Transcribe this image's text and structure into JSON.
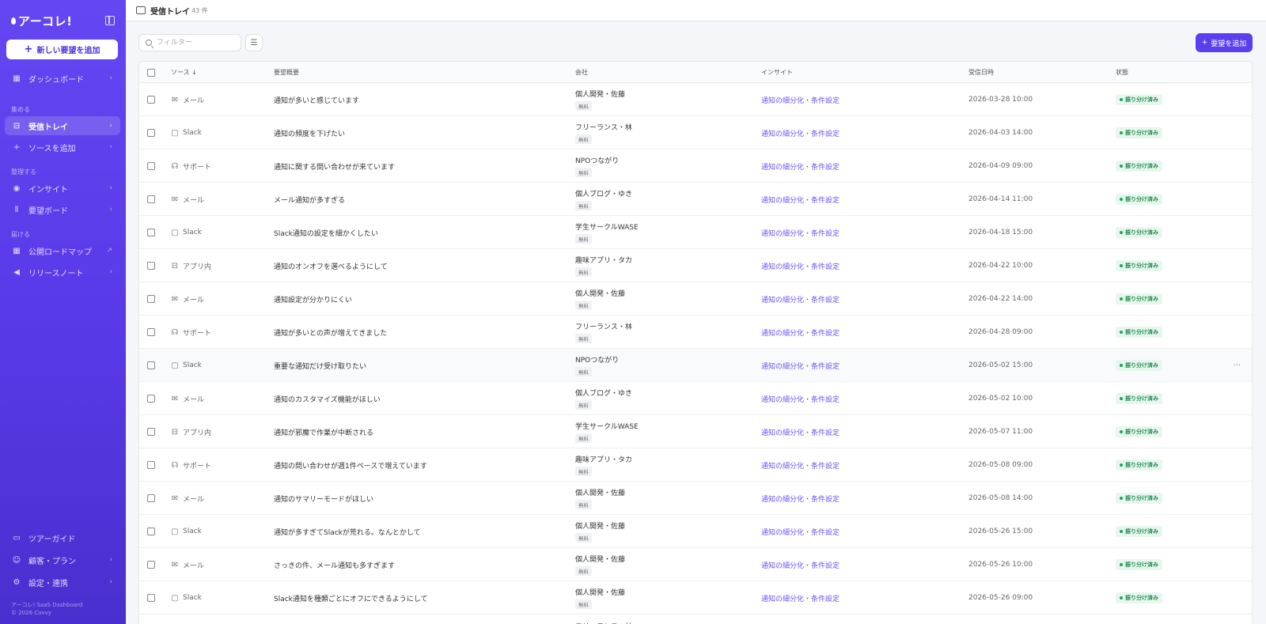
{
  "sidebar": {
    "logo": "アーコレ!",
    "new_button": "新しい要望を追加",
    "dashboard": "ダッシュボード",
    "section_collect": "集める",
    "inbox": "受信トレイ",
    "add_source": "ソースを追加",
    "section_organize": "整理する",
    "insight": "インサイト",
    "board": "要望ボード",
    "section_deliver": "届ける",
    "roadmap": "公開ロードマップ",
    "release_notes": "リリースノート",
    "tour_guide": "ツアーガイド",
    "customers": "顧客・プラン",
    "settings": "設定・連携",
    "footer_line1": "アーコレ! SaaS Dashboard",
    "footer_line2": "© 2026 Covvy"
  },
  "header": {
    "title": "受信トレイ",
    "count": "43 件"
  },
  "toolbar": {
    "filter_placeholder": "フィルター",
    "add_button": "要望を追加"
  },
  "table": {
    "columns": {
      "source": "ソース ↓",
      "summary": "要望概要",
      "company": "会社",
      "insight": "インサイト",
      "date": "受信日時",
      "status": "状態"
    },
    "rows": [
      {
        "source": "メール",
        "icon": "mail",
        "summary": "通知が多いと感じています",
        "company": "個人開発・佐藤",
        "plan": "無料",
        "insight": "通知の細分化・条件設定",
        "date": "2026-03-28 10:00",
        "status": "振り分け済み"
      },
      {
        "source": "Slack",
        "icon": "chat",
        "summary": "通知の頻度を下げたい",
        "company": "フリーランス・林",
        "plan": "無料",
        "insight": "通知の細分化・条件設定",
        "date": "2026-04-03 14:00",
        "status": "振り分け済み"
      },
      {
        "source": "サポート",
        "icon": "headset",
        "summary": "通知に関する問い合わせが来ています",
        "company": "NPOつながり",
        "plan": "無料",
        "insight": "通知の細分化・条件設定",
        "date": "2026-04-09 09:00",
        "status": "振り分け済み"
      },
      {
        "source": "メール",
        "icon": "mail",
        "summary": "メール通知が多すぎる",
        "company": "個人ブログ・ゆき",
        "plan": "無料",
        "insight": "通知の細分化・条件設定",
        "date": "2026-04-14 11:00",
        "status": "振り分け済み"
      },
      {
        "source": "Slack",
        "icon": "chat",
        "summary": "Slack通知の設定を細かくしたい",
        "company": "学生サークルWASE",
        "plan": "無料",
        "insight": "通知の細分化・条件設定",
        "date": "2026-04-18 15:00",
        "status": "振り分け済み"
      },
      {
        "source": "アプリ内",
        "icon": "inbox",
        "summary": "通知のオンオフを選べるようにして",
        "company": "趣味アプリ・タカ",
        "plan": "無料",
        "insight": "通知の細分化・条件設定",
        "date": "2026-04-22 10:00",
        "status": "振り分け済み"
      },
      {
        "source": "メール",
        "icon": "mail",
        "summary": "通知設定が分かりにくい",
        "company": "個人開発・佐藤",
        "plan": "無料",
        "insight": "通知の細分化・条件設定",
        "date": "2026-04-22 14:00",
        "status": "振り分け済み"
      },
      {
        "source": "サポート",
        "icon": "headset",
        "summary": "通知が多いとの声が増えてきました",
        "company": "フリーランス・林",
        "plan": "無料",
        "insight": "通知の細分化・条件設定",
        "date": "2026-04-28 09:00",
        "status": "振り分け済み"
      },
      {
        "source": "Slack",
        "icon": "chat",
        "summary": "重要な通知だけ受け取りたい",
        "company": "NPOつながり",
        "plan": "無料",
        "insight": "通知の細分化・条件設定",
        "date": "2026-05-02 15:00",
        "status": "振り分け済み"
      },
      {
        "source": "メール",
        "icon": "mail",
        "summary": "通知のカスタマイズ機能がほしい",
        "company": "個人ブログ・ゆき",
        "plan": "無料",
        "insight": "通知の細分化・条件設定",
        "date": "2026-05-02 10:00",
        "status": "振り分け済み"
      },
      {
        "source": "アプリ内",
        "icon": "inbox",
        "summary": "通知が邪魔で作業が中断される",
        "company": "学生サークルWASE",
        "plan": "無料",
        "insight": "通知の細分化・条件設定",
        "date": "2026-05-07 11:00",
        "status": "振り分け済み"
      },
      {
        "source": "サポート",
        "icon": "headset",
        "summary": "通知の問い合わせが週1件ペースで増えています",
        "company": "趣味アプリ・タカ",
        "plan": "無料",
        "insight": "通知の細分化・条件設定",
        "date": "2026-05-08 09:00",
        "status": "振り分け済み"
      },
      {
        "source": "メール",
        "icon": "mail",
        "summary": "通知のサマリーモードがほしい",
        "company": "個人開発・佐藤",
        "plan": "無料",
        "insight": "通知の細分化・条件設定",
        "date": "2026-05-08 14:00",
        "status": "振り分け済み"
      },
      {
        "source": "Slack",
        "icon": "chat",
        "summary": "通知が多すぎてSlackが荒れる。なんとかして",
        "company": "個人開発・佐藤",
        "plan": "無料",
        "insight": "通知の細分化・条件設定",
        "date": "2026-05-26 15:00",
        "status": "振り分け済み"
      },
      {
        "source": "メール",
        "icon": "mail",
        "summary": "さっきの件、メール通知も多すぎます",
        "company": "個人開発・佐藤",
        "plan": "無料",
        "insight": "通知の細分化・条件設定",
        "date": "2026-05-26 10:00",
        "status": "振り分け済み"
      },
      {
        "source": "Slack",
        "icon": "chat",
        "summary": "Slack通知を種類ごとにオフにできるようにして",
        "company": "個人開発・佐藤",
        "plan": "無料",
        "insight": "通知の細分化・条件設定",
        "date": "2026-05-26 09:00",
        "status": "振り分け済み"
      },
      {
        "source": "",
        "icon": "",
        "summary": "",
        "company": "フリーランス・林",
        "plan": "",
        "insight": "",
        "date": "",
        "status": ""
      }
    ]
  }
}
